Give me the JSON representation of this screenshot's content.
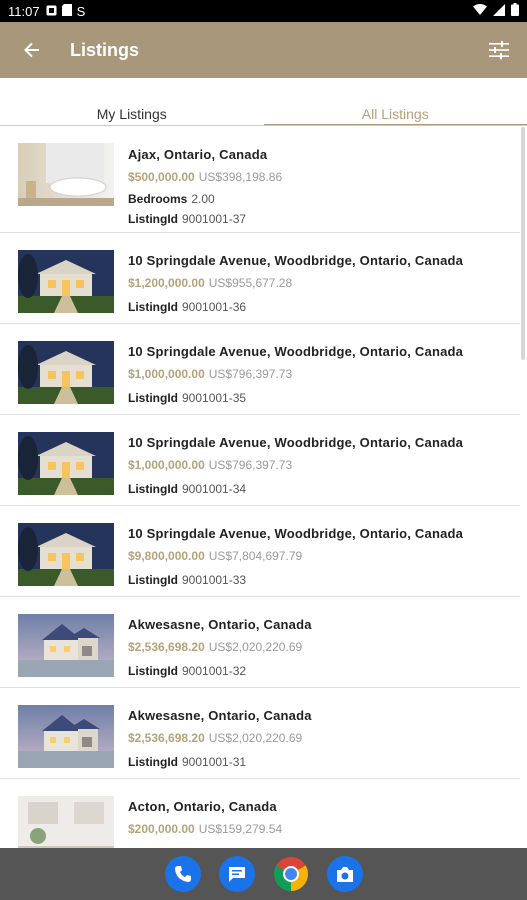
{
  "colors": {
    "brand": "#a8977a",
    "accent_text": "#b5a27a",
    "divider": "#e0e0e0"
  },
  "status": {
    "time": "11:07",
    "carrier_glyph": "S"
  },
  "appbar": {
    "title": "Listings",
    "back_icon": "arrow-back-icon",
    "filter_icon": "sliders-icon"
  },
  "tabs": [
    {
      "label": "My Listings",
      "selected": false
    },
    {
      "label": "All Listings",
      "selected": true
    }
  ],
  "listings": [
    {
      "address": "Ajax, Ontario, Canada",
      "price": "$500,000.00",
      "converted": "US$398,198.86",
      "bedrooms_label": "Bedrooms",
      "bedrooms": "2.00",
      "id_label": "ListingId",
      "listing_id": "9001001-37",
      "image": "bath-interior"
    },
    {
      "address": "10 Springdale Avenue, Woodbridge, Ontario, Canada",
      "price": "$1,200,000.00",
      "converted": "US$955,677.28",
      "id_label": "ListingId",
      "listing_id": "9001001-36",
      "image": "house-night"
    },
    {
      "address": "10 Springdale Avenue, Woodbridge, Ontario, Canada",
      "price": "$1,000,000.00",
      "converted": "US$796,397.73",
      "id_label": "ListingId",
      "listing_id": "9001001-35",
      "image": "house-night"
    },
    {
      "address": "10 Springdale Avenue, Woodbridge, Ontario, Canada",
      "price": "$1,000,000.00",
      "converted": "US$796,397.73",
      "id_label": "ListingId",
      "listing_id": "9001001-34",
      "image": "house-night"
    },
    {
      "address": "10 Springdale Avenue, Woodbridge, Ontario, Canada",
      "price": "$9,800,000.00",
      "converted": "US$7,804,697.79",
      "id_label": "ListingId",
      "listing_id": "9001001-33",
      "image": "house-night"
    },
    {
      "address": "Akwesasne, Ontario, Canada",
      "price": "$2,536,698.20",
      "converted": "US$2,020,220.69",
      "id_label": "ListingId",
      "listing_id": "9001001-32",
      "image": "house-dusk"
    },
    {
      "address": "Akwesasne, Ontario, Canada",
      "price": "$2,536,698.20",
      "converted": "US$2,020,220.69",
      "id_label": "ListingId",
      "listing_id": "9001001-31",
      "image": "house-dusk"
    },
    {
      "address": "Acton, Ontario, Canada",
      "price": "$200,000.00",
      "converted": "US$159,279.54",
      "id_label": "",
      "listing_id": "",
      "image": "living-room"
    }
  ],
  "dock": [
    {
      "name": "phone-app-icon"
    },
    {
      "name": "messages-app-icon"
    },
    {
      "name": "chrome-app-icon"
    },
    {
      "name": "camera-app-icon"
    }
  ]
}
